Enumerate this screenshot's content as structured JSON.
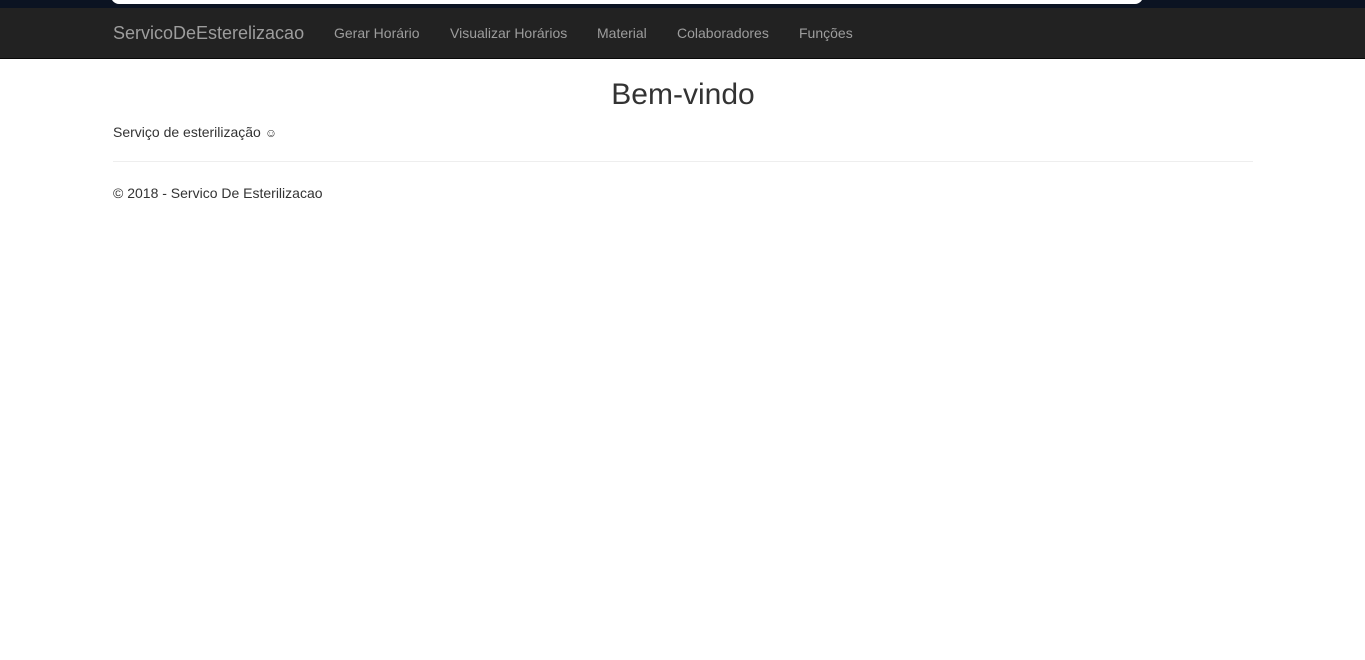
{
  "navbar": {
    "brand": "ServicoDeEsterelizacao",
    "items": [
      {
        "label": "Gerar Horário"
      },
      {
        "label": "Visualizar Horários"
      },
      {
        "label": "Material"
      },
      {
        "label": "Colaboradores"
      },
      {
        "label": "Funções"
      }
    ]
  },
  "main": {
    "title": "Bem-vindo",
    "intro": "Serviço de esterilização",
    "intro_icon": "☺"
  },
  "footer": {
    "text": "© 2018 - Servico De Esterilizacao"
  },
  "colors": {
    "navbar_bg": "#222222",
    "navbar_text": "#9d9d9d",
    "top_strip": "#0b1322"
  }
}
